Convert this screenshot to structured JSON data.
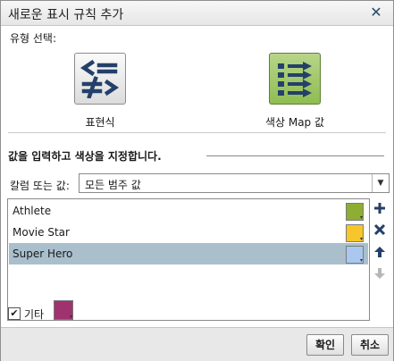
{
  "dialog": {
    "title": "새로운 표시 규칙 추가",
    "close_glyph": "✕"
  },
  "type_select": {
    "label": "유형 선택:",
    "options": [
      {
        "label": "표현식",
        "icon": "expression-icon"
      },
      {
        "label": "색상 Map 값",
        "icon": "color-map-icon"
      }
    ]
  },
  "assign": {
    "heading": "값을 입력하고 색상을 지정합니다.",
    "column_label": "칼럼 또는 값:",
    "column_value": "모든 범주 값"
  },
  "items": [
    {
      "label": "Athlete",
      "color": "#8fad32"
    },
    {
      "label": "Movie Star",
      "color": "#f7c62a"
    },
    {
      "label": "Super Hero",
      "color": "#a9c8ef",
      "selected": true
    }
  ],
  "other": {
    "label": "기타",
    "checked": true,
    "color": "#a0336f"
  },
  "footer": {
    "ok": "확인",
    "cancel": "취소"
  },
  "colors": {
    "accent_blue": "#24406a",
    "selection": "#a9bfcc",
    "disabled": "#b6b6b6"
  }
}
